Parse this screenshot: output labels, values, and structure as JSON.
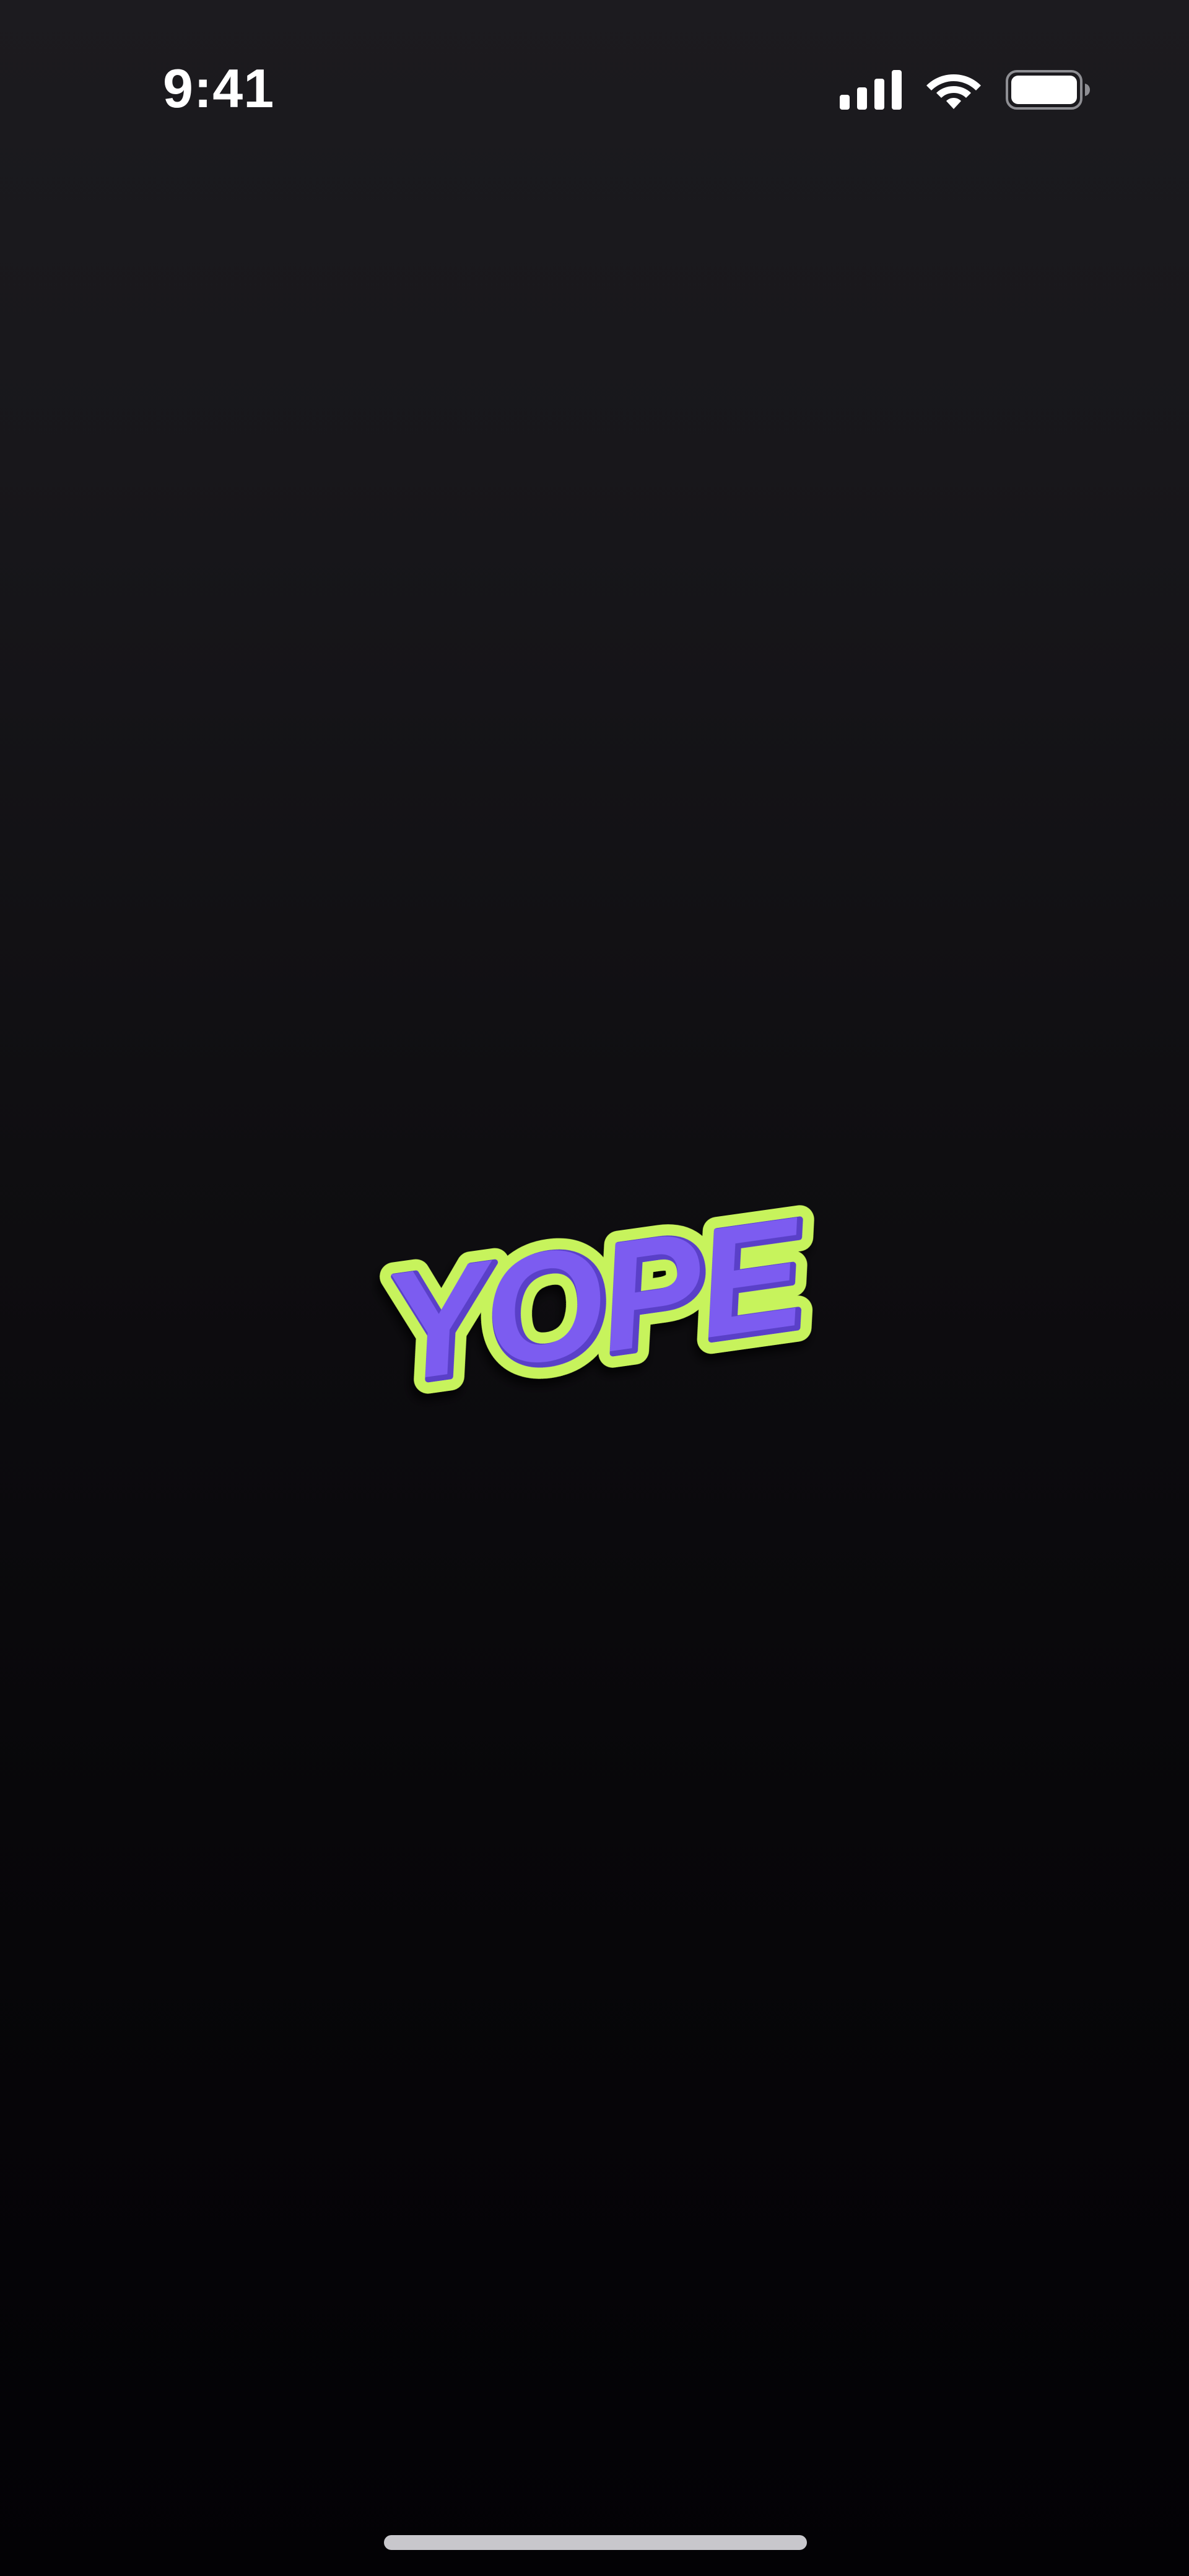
{
  "status_bar": {
    "time": "9:41",
    "icons": [
      "cellular-signal-icon",
      "wifi-icon",
      "battery-icon"
    ],
    "icon_color": "#ffffff"
  },
  "splash": {
    "logo_text": "YOPE",
    "logo_fill_color": "#7b5cf0",
    "logo_outline_color": "#c7f35b"
  },
  "colors": {
    "background_top": "#1c1b1f",
    "background_bottom": "#030205",
    "home_indicator": "#c8c7cc"
  }
}
